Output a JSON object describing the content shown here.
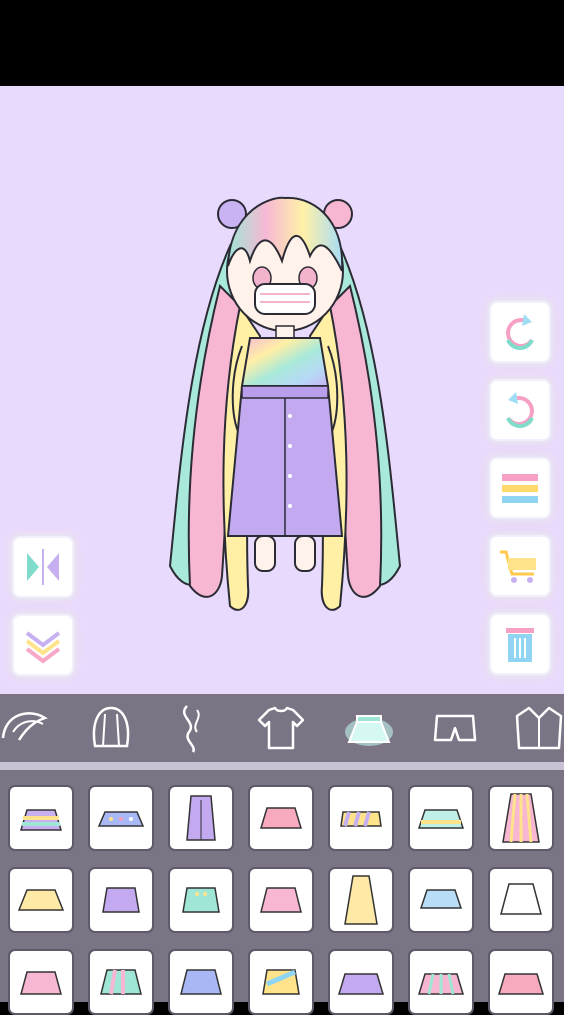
{
  "app": {
    "name": ""
  },
  "colors": {
    "stage_bg": "#E8DAFC",
    "toolbar_bg": "#7A7485",
    "selected_category_glow": "#BFF3EC",
    "icon_outline": "#FFFFFF"
  },
  "side_buttons": {
    "left": [
      "flip-icon",
      "chevron-down-icon"
    ],
    "right": [
      "undo-icon",
      "redo-icon",
      "menu-icon",
      "cart-icon",
      "trash-icon"
    ]
  },
  "categories": [
    {
      "icon": "front-hair-icon",
      "selected": false
    },
    {
      "icon": "back-hair-icon",
      "selected": false
    },
    {
      "icon": "hair-accessory-icon",
      "selected": false
    },
    {
      "icon": "shirt-icon",
      "selected": false
    },
    {
      "icon": "skirt-icon",
      "selected": true
    },
    {
      "icon": "shorts-icon",
      "selected": false
    },
    {
      "icon": "jacket-icon",
      "selected": false
    }
  ],
  "items": [
    {
      "icon": "layered-skirt-icon"
    },
    {
      "icon": "star-tutu-skirt-icon"
    },
    {
      "icon": "long-button-skirt-icon"
    },
    {
      "icon": "pink-scallop-skirt-icon"
    },
    {
      "icon": "striped-mini-skirt-icon"
    },
    {
      "icon": "frilly-tiered-skirt-icon"
    },
    {
      "icon": "rainbow-pleated-maxi-skirt-icon"
    },
    {
      "icon": "yellow-flared-skirt-icon"
    },
    {
      "icon": "purple-a-line-skirt-icon"
    },
    {
      "icon": "mint-button-skirt-icon"
    },
    {
      "icon": "pink-pleated-skirt-icon"
    },
    {
      "icon": "yellow-long-pleated-skirt-icon"
    },
    {
      "icon": "blue-flared-skirt-icon"
    },
    {
      "icon": "white-flared-skirt-icon"
    },
    {
      "icon": "pink-skirt-icon"
    },
    {
      "icon": "rainbow-panel-skirt-icon"
    },
    {
      "icon": "blue-pleated-skirt-icon"
    },
    {
      "icon": "diagonal-stripe-skirt-icon"
    },
    {
      "icon": "purple-ruffle-skirt-icon"
    },
    {
      "icon": "rainbow-ruffle-skirt-icon"
    },
    {
      "icon": "pink-tiered-skirt-icon"
    }
  ]
}
